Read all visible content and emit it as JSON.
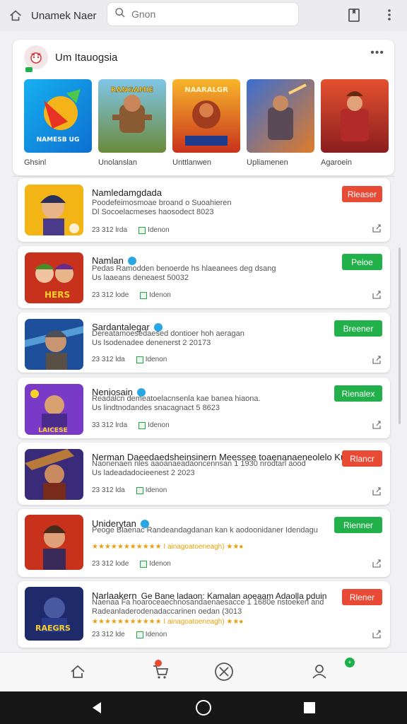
{
  "header": {
    "title": "Unamek Naer",
    "search_placeholder": "Gnon"
  },
  "featured": {
    "title": "Um Itauogsia",
    "menu": "•••",
    "tiles": [
      {
        "label": "Ghsinl",
        "art_text": "NAMESB UG"
      },
      {
        "label": "Unolanslan",
        "art_text": "RANGAMIE"
      },
      {
        "label": "Unttlanwen",
        "art_text": "NAARALGR"
      },
      {
        "label": "Upliamenen",
        "art_text": ""
      },
      {
        "label": "Agaroein",
        "art_text": ""
      }
    ]
  },
  "apps": [
    {
      "name": "Namledamgdada",
      "verified": false,
      "desc1": "Poodefeimosmoae broand o Suoahieren",
      "desc2": "Dl Socoelacmeses haosodect 8023",
      "rating": "",
      "stats": "23 312 lrda",
      "installed": "Idenon",
      "action": "Rleaser",
      "action_color": "red",
      "icon_text": ""
    },
    {
      "name": "Namlan",
      "verified": true,
      "desc1": "Pedas Ramodden benoerde hs hlaeanees deg dsang",
      "desc2": "Us laaeans deneaest 50032",
      "rating": "",
      "stats": "23 312 lode",
      "installed": "Idenon",
      "action": "Peioe",
      "action_color": "green",
      "icon_text": "HERS"
    },
    {
      "name": "Sardantalegar",
      "verified": true,
      "desc1": "Dereatamoesedaesed dontioer hoh aeragan",
      "desc2": "Us lsodenadee denenerst 2 20173",
      "rating": "",
      "stats": "23 312 lda",
      "installed": "Idenon",
      "action": "Breener",
      "action_color": "green",
      "icon_text": ""
    },
    {
      "name": "Neniosain",
      "verified": true,
      "desc1": "Readalcn demeatoelacnsenla kae banea hiaona.",
      "desc2": "Us lindtnodandes snacagnact 5 8623",
      "rating": "",
      "stats": "33 312 lrda",
      "installed": "Idenon",
      "action": "Rienalex",
      "action_color": "green",
      "icon_text": "LAICESE"
    },
    {
      "name": "Nerman Daeedaedsheinsinern Meessee toaenanaeneolelo Kuan",
      "verified": false,
      "desc1": "Naonenaen nles aaoanaeadaoncennsan 1 1930 nrodtarl aood",
      "desc2": "Us ladeadadocieenest 2 2023",
      "rating": "",
      "stats": "23 312 lda",
      "installed": "Idenon",
      "action": "Rlancr",
      "action_color": "red",
      "icon_text": ""
    },
    {
      "name": "Uniderytan",
      "verified": true,
      "desc1": "Peoge Blaenac Randeandagdanan kan k aodoonidaner Idendagu",
      "desc2": "",
      "rating": "★★★★★★★★★★★ I ainagoatoeneagh) ★★●",
      "stats": "23 312 lode",
      "installed": "Idenon",
      "action": "Rienner",
      "action_color": "green",
      "icon_text": ""
    },
    {
      "name": "Narlaakern",
      "verified": false,
      "name_suffix": "Ge Bane ladaon: Kamalan aoeaam Adaolla pduin",
      "desc1": "Naenaa Fa hoaroceaechnosandaenaesacce 1 1680e nstoekerl and",
      "desc2": "Radeanladerodenadaccarinen oedan (3013",
      "rating": "★★★★★★★★★★★ I ainagoatoeneagh) ★★●",
      "stats": "23 312 lde",
      "installed": "Idenon",
      "action": "Rlener",
      "action_color": "red",
      "icon_text": "RAEGRS"
    }
  ],
  "bottom_nav": {
    "home": "home-icon",
    "cart": "cart-icon",
    "explore": "compass-icon",
    "profile": "profile-icon",
    "profile_badge": "+"
  }
}
